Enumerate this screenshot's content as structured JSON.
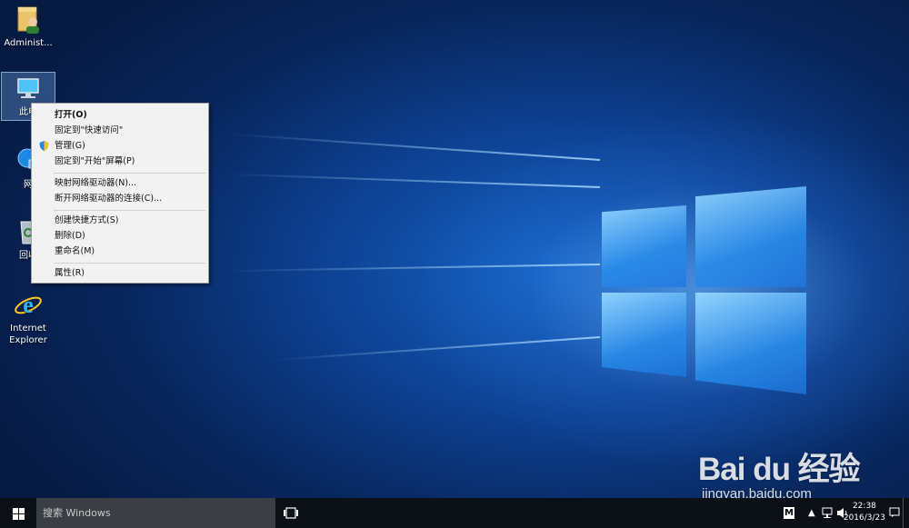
{
  "desktop": {
    "icons": [
      {
        "label": "Administ..."
      },
      {
        "label": "此电"
      },
      {
        "label": "网"
      },
      {
        "label": "回收"
      },
      {
        "label_line1": "Internet",
        "label_line2": "Explorer"
      }
    ]
  },
  "context_menu": {
    "items": [
      {
        "label": "打开(O)",
        "bold": true
      },
      {
        "label": "固定到\"快速访问\""
      },
      {
        "label": "管理(G)",
        "icon": "shield-icon"
      },
      {
        "label": "固定到\"开始\"屏幕(P)"
      },
      {
        "label": "映射网络驱动器(N)..."
      },
      {
        "label": "断开网络驱动器的连接(C)..."
      },
      {
        "label": "创建快捷方式(S)"
      },
      {
        "label": "删除(D)"
      },
      {
        "label": "重命名(M)"
      },
      {
        "label": "属性(R)"
      }
    ]
  },
  "taskbar": {
    "start_icon": "windows-logo-icon",
    "search_placeholder": "搜索 Windows",
    "task_view_icon": "task-view-icon",
    "tray": {
      "ime_label": "M",
      "time": "22:38",
      "date": "2016/3/23"
    }
  },
  "watermark": {
    "logo": "Bai du 经验",
    "url": "jingyan.baidu.com"
  },
  "colors": {
    "taskbar_bg": "#0b0f16",
    "search_bg": "#3b3f45",
    "menu_bg": "#f2f2f2",
    "wallpaper_blue": "#1565c8"
  }
}
